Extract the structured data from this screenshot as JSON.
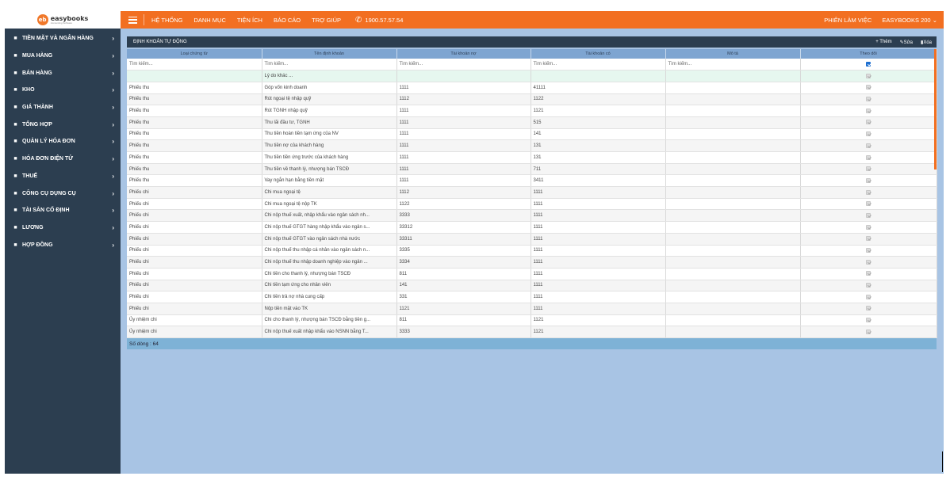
{
  "logo": {
    "mark": "eb",
    "name": "easybooks",
    "tagline": "Accounting Software"
  },
  "sidebar": {
    "items": [
      {
        "label": "TIỀN MẶT VÀ NGÂN HÀNG",
        "icon": "bank-icon"
      },
      {
        "label": "MUA HÀNG",
        "icon": "cart-icon"
      },
      {
        "label": "BÁN HÀNG",
        "icon": "cart-icon"
      },
      {
        "label": "KHO",
        "icon": "warehouse-icon"
      },
      {
        "label": "GIÁ THÀNH",
        "icon": "document-icon"
      },
      {
        "label": "TỔNG HỢP",
        "icon": "document-icon"
      },
      {
        "label": "QUẢN LÝ HÓA ĐƠN",
        "icon": "gear-icon"
      },
      {
        "label": "HÓA ĐƠN ĐIỆN TỬ",
        "icon": "document-icon"
      },
      {
        "label": "THUẾ",
        "icon": "tax-icon"
      },
      {
        "label": "CÔNG CỤ DỤNG CỤ",
        "icon": "document-icon"
      },
      {
        "label": "TÀI SẢN CỐ ĐỊNH",
        "icon": "building-icon"
      },
      {
        "label": "LƯƠNG",
        "icon": "user-icon"
      },
      {
        "label": "HỢP ĐỒNG",
        "icon": "handshake-icon"
      }
    ]
  },
  "topbar": {
    "nav": [
      "HỆ THỐNG",
      "DANH MỤC",
      "TIỆN ÍCH",
      "BÁO CÁO",
      "TRỢ GIÚP"
    ],
    "phone": "1900.57.57.54",
    "session": "PHIÊN LÀM VIỆC",
    "company": "EASYBOOKS 200"
  },
  "panel": {
    "title": "ĐỊNH KHOẢN TỰ ĐỘNG",
    "add": "+ Thêm",
    "edit": "Sửa",
    "delete": "Xóa"
  },
  "table": {
    "columns": [
      "Loại chứng từ",
      "Tên định khoản",
      "Tài khoản nợ",
      "Tài khoản có",
      "Mô tả",
      "Theo dõi"
    ],
    "filters": [
      "Tìm kiếm...",
      "Tìm kiếm...",
      "Tìm kiếm...",
      "Tìm kiếm...",
      "Tìm kiếm..."
    ],
    "rows": [
      {
        "type": "",
        "name": "Lý do khác ...",
        "debit": "",
        "credit": "",
        "desc": ""
      },
      {
        "type": "Phiếu thu",
        "name": "Góp vốn kinh doanh",
        "debit": "1111",
        "credit": "41111",
        "desc": ""
      },
      {
        "type": "Phiếu thu",
        "name": "Rút ngoại tệ nhập quỹ",
        "debit": "1112",
        "credit": "1122",
        "desc": ""
      },
      {
        "type": "Phiếu thu",
        "name": "Rút TGNH nhập quỹ",
        "debit": "1111",
        "credit": "1121",
        "desc": ""
      },
      {
        "type": "Phiếu thu",
        "name": "Thu lãi đầu tư, TGNH",
        "debit": "1111",
        "credit": "515",
        "desc": ""
      },
      {
        "type": "Phiếu thu",
        "name": "Thu tiền hoàn tiền tạm ứng của NV",
        "debit": "1111",
        "credit": "141",
        "desc": ""
      },
      {
        "type": "Phiếu thu",
        "name": "Thu tiền nợ của khách hàng",
        "debit": "1111",
        "credit": "131",
        "desc": ""
      },
      {
        "type": "Phiếu thu",
        "name": "Thu tiền tiền ứng trước của khách hàng",
        "debit": "1111",
        "credit": "131",
        "desc": ""
      },
      {
        "type": "Phiếu thu",
        "name": "Thu tiền về thanh lý, nhượng bán TSCĐ",
        "debit": "1111",
        "credit": "711",
        "desc": ""
      },
      {
        "type": "Phiếu thu",
        "name": "Vay ngắn hạn bằng tiền mặt",
        "debit": "1111",
        "credit": "3411",
        "desc": ""
      },
      {
        "type": "Phiếu chi",
        "name": "Chi mua ngoại tệ",
        "debit": "1112",
        "credit": "1111",
        "desc": ""
      },
      {
        "type": "Phiếu chi",
        "name": "Chi mua ngoại tệ nộp TK",
        "debit": "1122",
        "credit": "1111",
        "desc": ""
      },
      {
        "type": "Phiếu chi",
        "name": "Chi nộp thuế xuất, nhập khẩu vào ngân sách nh...",
        "debit": "3333",
        "credit": "1111",
        "desc": ""
      },
      {
        "type": "Phiếu chi",
        "name": "Chi nộp thuế GTGT hàng nhập khẩu vào ngân s...",
        "debit": "33312",
        "credit": "1111",
        "desc": ""
      },
      {
        "type": "Phiếu chi",
        "name": "Chi nộp thuế GTGT vào ngân sách nhà nước",
        "debit": "33311",
        "credit": "1111",
        "desc": ""
      },
      {
        "type": "Phiếu chi",
        "name": "Chi nộp thuế thu nhập cá nhân vào ngân sách n...",
        "debit": "3335",
        "credit": "1111",
        "desc": ""
      },
      {
        "type": "Phiếu chi",
        "name": "Chi nộp thuế thu nhập doanh nghiệp vào ngân ...",
        "debit": "3334",
        "credit": "1111",
        "desc": ""
      },
      {
        "type": "Phiếu chi",
        "name": "Chi tiền cho thanh lý, nhượng bán TSCĐ",
        "debit": "811",
        "credit": "1111",
        "desc": ""
      },
      {
        "type": "Phiếu chi",
        "name": "Chi tiền tạm ứng cho nhân viên",
        "debit": "141",
        "credit": "1111",
        "desc": ""
      },
      {
        "type": "Phiếu chi",
        "name": "Chi tiền trả nợ nhà cung cấp",
        "debit": "331",
        "credit": "1111",
        "desc": ""
      },
      {
        "type": "Phiếu chi",
        "name": "Nộp tiền mặt vào TK",
        "debit": "1121",
        "credit": "1111",
        "desc": ""
      },
      {
        "type": "Ủy nhiệm chi",
        "name": "Chi cho thanh lý, nhượng bán TSCĐ bằng tiền g...",
        "debit": "811",
        "credit": "1121",
        "desc": ""
      },
      {
        "type": "Ủy nhiệm chi",
        "name": "Chi nộp thuế xuất nhập khẩu vào NSNN bằng T...",
        "debit": "3333",
        "credit": "1121",
        "desc": ""
      }
    ],
    "footer": "Số dòng : 64"
  }
}
